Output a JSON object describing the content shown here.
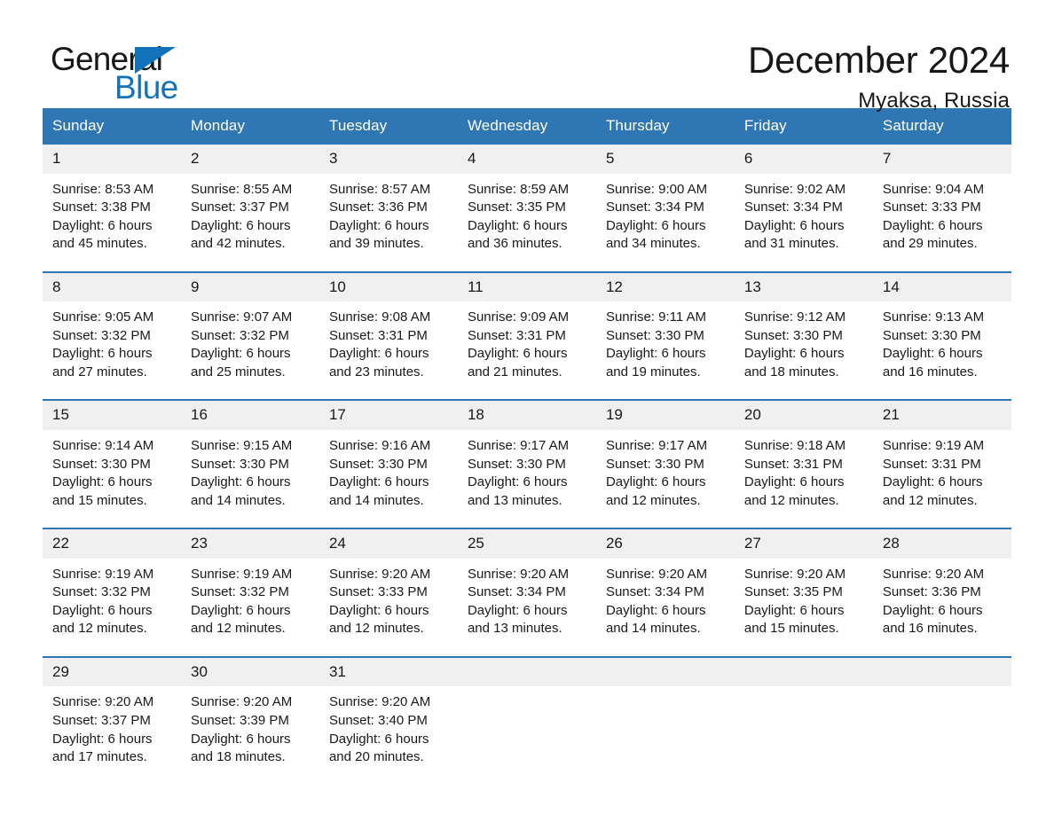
{
  "brand": {
    "name_part1": "General",
    "name_part2": "Blue",
    "triangle_color": "#1273ba",
    "text_color": "#17181a"
  },
  "header": {
    "title": "December 2024",
    "location": "Myaksa, Russia"
  },
  "theme": {
    "header_blue": "#2f76b5",
    "daynum_band": "#f0f0f0",
    "page_background": "#ffffff",
    "body_text": "#1a1a1a"
  },
  "weekday_headers": [
    "Sunday",
    "Monday",
    "Tuesday",
    "Wednesday",
    "Thursday",
    "Friday",
    "Saturday"
  ],
  "weeks": [
    {
      "days": [
        {
          "num": "1",
          "sunrise": "Sunrise: 8:53 AM",
          "sunset": "Sunset: 3:38 PM",
          "daylight_line1": "Daylight: 6 hours",
          "daylight_line2": "and 45 minutes."
        },
        {
          "num": "2",
          "sunrise": "Sunrise: 8:55 AM",
          "sunset": "Sunset: 3:37 PM",
          "daylight_line1": "Daylight: 6 hours",
          "daylight_line2": "and 42 minutes."
        },
        {
          "num": "3",
          "sunrise": "Sunrise: 8:57 AM",
          "sunset": "Sunset: 3:36 PM",
          "daylight_line1": "Daylight: 6 hours",
          "daylight_line2": "and 39 minutes."
        },
        {
          "num": "4",
          "sunrise": "Sunrise: 8:59 AM",
          "sunset": "Sunset: 3:35 PM",
          "daylight_line1": "Daylight: 6 hours",
          "daylight_line2": "and 36 minutes."
        },
        {
          "num": "5",
          "sunrise": "Sunrise: 9:00 AM",
          "sunset": "Sunset: 3:34 PM",
          "daylight_line1": "Daylight: 6 hours",
          "daylight_line2": "and 34 minutes."
        },
        {
          "num": "6",
          "sunrise": "Sunrise: 9:02 AM",
          "sunset": "Sunset: 3:34 PM",
          "daylight_line1": "Daylight: 6 hours",
          "daylight_line2": "and 31 minutes."
        },
        {
          "num": "7",
          "sunrise": "Sunrise: 9:04 AM",
          "sunset": "Sunset: 3:33 PM",
          "daylight_line1": "Daylight: 6 hours",
          "daylight_line2": "and 29 minutes."
        }
      ]
    },
    {
      "days": [
        {
          "num": "8",
          "sunrise": "Sunrise: 9:05 AM",
          "sunset": "Sunset: 3:32 PM",
          "daylight_line1": "Daylight: 6 hours",
          "daylight_line2": "and 27 minutes."
        },
        {
          "num": "9",
          "sunrise": "Sunrise: 9:07 AM",
          "sunset": "Sunset: 3:32 PM",
          "daylight_line1": "Daylight: 6 hours",
          "daylight_line2": "and 25 minutes."
        },
        {
          "num": "10",
          "sunrise": "Sunrise: 9:08 AM",
          "sunset": "Sunset: 3:31 PM",
          "daylight_line1": "Daylight: 6 hours",
          "daylight_line2": "and 23 minutes."
        },
        {
          "num": "11",
          "sunrise": "Sunrise: 9:09 AM",
          "sunset": "Sunset: 3:31 PM",
          "daylight_line1": "Daylight: 6 hours",
          "daylight_line2": "and 21 minutes."
        },
        {
          "num": "12",
          "sunrise": "Sunrise: 9:11 AM",
          "sunset": "Sunset: 3:30 PM",
          "daylight_line1": "Daylight: 6 hours",
          "daylight_line2": "and 19 minutes."
        },
        {
          "num": "13",
          "sunrise": "Sunrise: 9:12 AM",
          "sunset": "Sunset: 3:30 PM",
          "daylight_line1": "Daylight: 6 hours",
          "daylight_line2": "and 18 minutes."
        },
        {
          "num": "14",
          "sunrise": "Sunrise: 9:13 AM",
          "sunset": "Sunset: 3:30 PM",
          "daylight_line1": "Daylight: 6 hours",
          "daylight_line2": "and 16 minutes."
        }
      ]
    },
    {
      "days": [
        {
          "num": "15",
          "sunrise": "Sunrise: 9:14 AM",
          "sunset": "Sunset: 3:30 PM",
          "daylight_line1": "Daylight: 6 hours",
          "daylight_line2": "and 15 minutes."
        },
        {
          "num": "16",
          "sunrise": "Sunrise: 9:15 AM",
          "sunset": "Sunset: 3:30 PM",
          "daylight_line1": "Daylight: 6 hours",
          "daylight_line2": "and 14 minutes."
        },
        {
          "num": "17",
          "sunrise": "Sunrise: 9:16 AM",
          "sunset": "Sunset: 3:30 PM",
          "daylight_line1": "Daylight: 6 hours",
          "daylight_line2": "and 14 minutes."
        },
        {
          "num": "18",
          "sunrise": "Sunrise: 9:17 AM",
          "sunset": "Sunset: 3:30 PM",
          "daylight_line1": "Daylight: 6 hours",
          "daylight_line2": "and 13 minutes."
        },
        {
          "num": "19",
          "sunrise": "Sunrise: 9:17 AM",
          "sunset": "Sunset: 3:30 PM",
          "daylight_line1": "Daylight: 6 hours",
          "daylight_line2": "and 12 minutes."
        },
        {
          "num": "20",
          "sunrise": "Sunrise: 9:18 AM",
          "sunset": "Sunset: 3:31 PM",
          "daylight_line1": "Daylight: 6 hours",
          "daylight_line2": "and 12 minutes."
        },
        {
          "num": "21",
          "sunrise": "Sunrise: 9:19 AM",
          "sunset": "Sunset: 3:31 PM",
          "daylight_line1": "Daylight: 6 hours",
          "daylight_line2": "and 12 minutes."
        }
      ]
    },
    {
      "days": [
        {
          "num": "22",
          "sunrise": "Sunrise: 9:19 AM",
          "sunset": "Sunset: 3:32 PM",
          "daylight_line1": "Daylight: 6 hours",
          "daylight_line2": "and 12 minutes."
        },
        {
          "num": "23",
          "sunrise": "Sunrise: 9:19 AM",
          "sunset": "Sunset: 3:32 PM",
          "daylight_line1": "Daylight: 6 hours",
          "daylight_line2": "and 12 minutes."
        },
        {
          "num": "24",
          "sunrise": "Sunrise: 9:20 AM",
          "sunset": "Sunset: 3:33 PM",
          "daylight_line1": "Daylight: 6 hours",
          "daylight_line2": "and 12 minutes."
        },
        {
          "num": "25",
          "sunrise": "Sunrise: 9:20 AM",
          "sunset": "Sunset: 3:34 PM",
          "daylight_line1": "Daylight: 6 hours",
          "daylight_line2": "and 13 minutes."
        },
        {
          "num": "26",
          "sunrise": "Sunrise: 9:20 AM",
          "sunset": "Sunset: 3:34 PM",
          "daylight_line1": "Daylight: 6 hours",
          "daylight_line2": "and 14 minutes."
        },
        {
          "num": "27",
          "sunrise": "Sunrise: 9:20 AM",
          "sunset": "Sunset: 3:35 PM",
          "daylight_line1": "Daylight: 6 hours",
          "daylight_line2": "and 15 minutes."
        },
        {
          "num": "28",
          "sunrise": "Sunrise: 9:20 AM",
          "sunset": "Sunset: 3:36 PM",
          "daylight_line1": "Daylight: 6 hours",
          "daylight_line2": "and 16 minutes."
        }
      ]
    },
    {
      "days": [
        {
          "num": "29",
          "sunrise": "Sunrise: 9:20 AM",
          "sunset": "Sunset: 3:37 PM",
          "daylight_line1": "Daylight: 6 hours",
          "daylight_line2": "and 17 minutes."
        },
        {
          "num": "30",
          "sunrise": "Sunrise: 9:20 AM",
          "sunset": "Sunset: 3:39 PM",
          "daylight_line1": "Daylight: 6 hours",
          "daylight_line2": "and 18 minutes."
        },
        {
          "num": "31",
          "sunrise": "Sunrise: 9:20 AM",
          "sunset": "Sunset: 3:40 PM",
          "daylight_line1": "Daylight: 6 hours",
          "daylight_line2": "and 20 minutes."
        },
        {
          "num": "",
          "sunrise": "",
          "sunset": "",
          "daylight_line1": "",
          "daylight_line2": ""
        },
        {
          "num": "",
          "sunrise": "",
          "sunset": "",
          "daylight_line1": "",
          "daylight_line2": ""
        },
        {
          "num": "",
          "sunrise": "",
          "sunset": "",
          "daylight_line1": "",
          "daylight_line2": ""
        },
        {
          "num": "",
          "sunrise": "",
          "sunset": "",
          "daylight_line1": "",
          "daylight_line2": ""
        }
      ]
    }
  ]
}
